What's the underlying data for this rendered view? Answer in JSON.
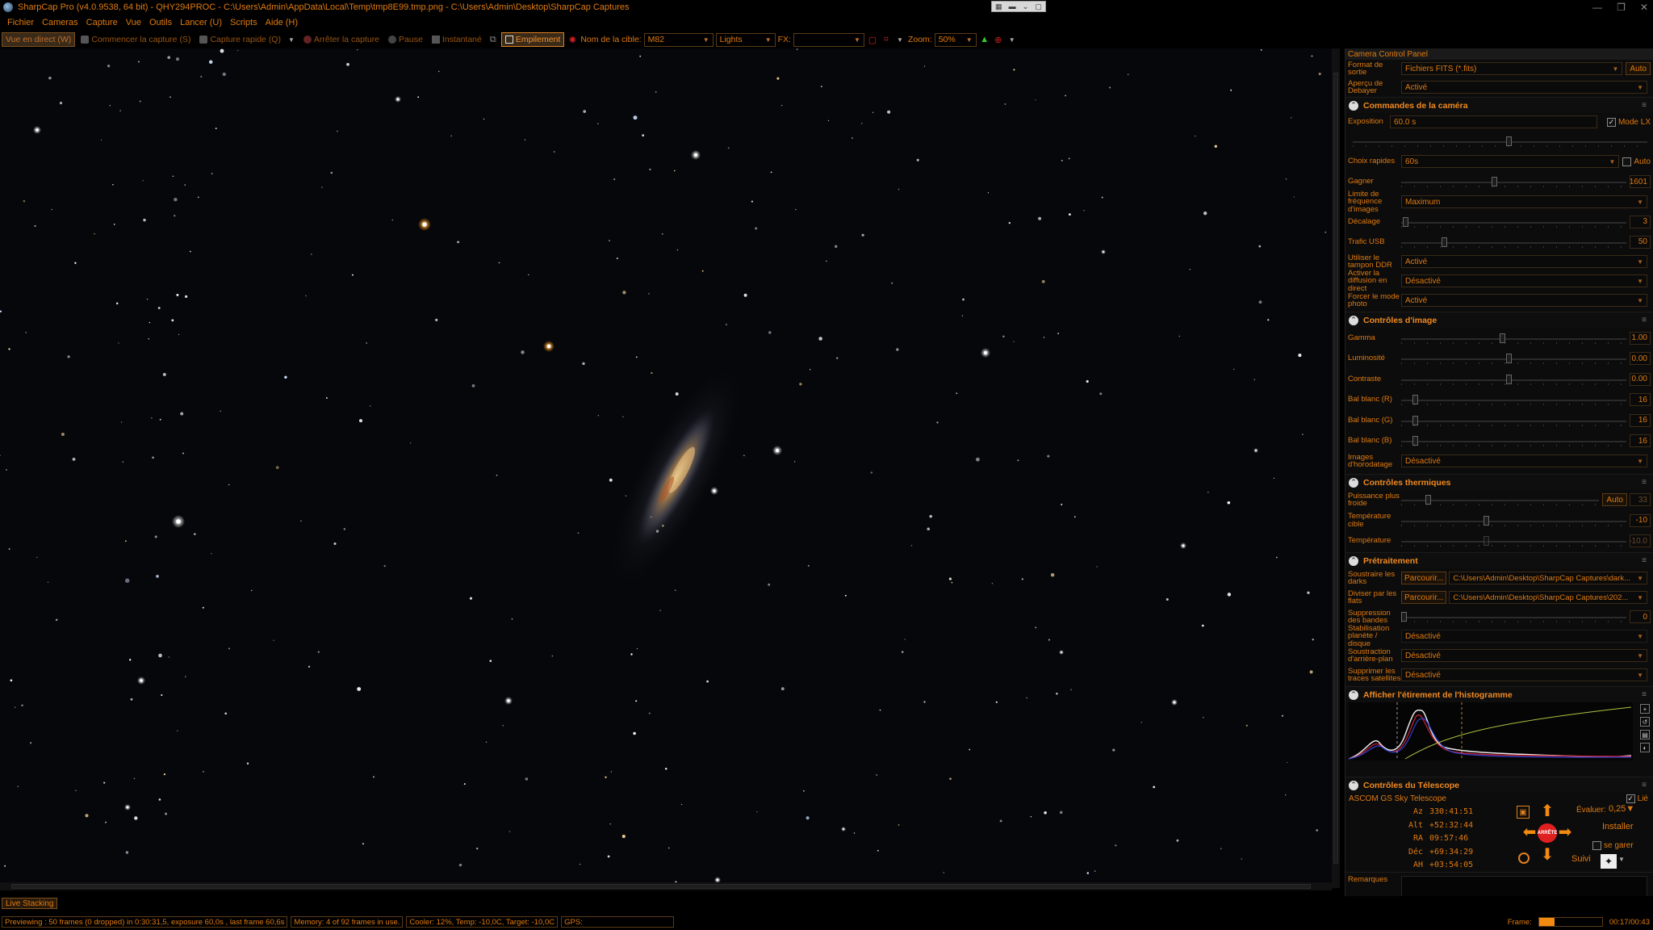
{
  "window": {
    "title": "SharpCap Pro (v4.0.9538, 64 bit) - QHY294PROC - C:\\Users\\Admin\\AppData\\Local\\Temp\\tmp8E99.tmp.png - C:\\Users\\Admin\\Desktop\\SharpCap Captures",
    "controls": [
      "—",
      "❐",
      "✕"
    ]
  },
  "menu": [
    "Fichier",
    "Cameras",
    "Capture",
    "Vue",
    "Outils",
    "Lancer (U)",
    "Scripts",
    "Aide (H)"
  ],
  "toolbar": {
    "live_view": "Vue en direct (W)",
    "start_capture": "Commencer la capture (S)",
    "quick_capture": "Capture rapide (Q)",
    "stop_capture": "Arrêter la capture",
    "pause": "Pause",
    "snapshot": "Instantané",
    "stacking": "Empilement",
    "target_label": "Nom de la cible:",
    "target_value": "M82",
    "frame_type": "Lights",
    "fx_label": "FX:",
    "fx_value": "",
    "zoom_label": "Zoom:",
    "zoom_value": "50%"
  },
  "panel": {
    "title": "Camera Control Panel",
    "output_format": {
      "label": "Format de sortie",
      "value": "Fichiers FITS (*.fits)",
      "auto": "Auto"
    },
    "debayer_preview": {
      "label": "Aperçu de Debayer",
      "value": "Activé"
    },
    "camera_controls": {
      "title": "Commandes de la caméra",
      "exposure": {
        "label": "Exposition",
        "value": "60.0 s",
        "lx_mode": "Mode LX"
      },
      "quick_picks": {
        "label": "Choix rapides",
        "value": "60s",
        "auto": "Auto"
      },
      "gain": {
        "label": "Gagner",
        "value": "1601"
      },
      "frame_limit": {
        "label": "Limite de fréquence d'images",
        "value": "Maximum"
      },
      "offset": {
        "label": "Décalage",
        "value": "3"
      },
      "usb_traffic": {
        "label": "Trafic USB",
        "value": "50"
      },
      "ddr_buffer": {
        "label": "Utiliser le tampon DDR",
        "value": "Activé"
      },
      "live_broadcast": {
        "label": "Activer la diffusion en direct",
        "value": "Désactivé"
      },
      "photo_mode": {
        "label": "Forcer le mode photo",
        "value": "Activé"
      }
    },
    "image_controls": {
      "title": "Contrôles d'image",
      "gamma": {
        "label": "Gamma",
        "value": "1.00"
      },
      "brightness": {
        "label": "Luminosité",
        "value": "0.00"
      },
      "contrast": {
        "label": "Contraste",
        "value": "0.00"
      },
      "wb_r": {
        "label": "Bal blanc (R)",
        "value": "16"
      },
      "wb_g": {
        "label": "Bal blanc (G)",
        "value": "16"
      },
      "wb_b": {
        "label": "Bal blanc (B)",
        "value": "16"
      },
      "timestamp": {
        "label": "Images d'horodatage",
        "value": "Désactivé"
      }
    },
    "thermal_controls": {
      "title": "Contrôles thermiques",
      "cooler_power": {
        "label": "Puissance plus froide",
        "auto": "Auto",
        "value": "33"
      },
      "target_temp": {
        "label": "Température cible",
        "value": "-10"
      },
      "temperature": {
        "label": "Température",
        "value": "-10.0"
      }
    },
    "preprocessing": {
      "title": "Prétraitement",
      "subtract_darks": {
        "label": "Soustraire les darks",
        "browse": "Parcourir...",
        "path": "C:\\Users\\Admin\\Desktop\\SharpCap Captures\\dark..."
      },
      "divide_flats": {
        "label": "Diviser par les flats",
        "browse": "Parcourir...",
        "path": "C:\\Users\\Admin\\Desktop\\SharpCap Captures\\202..."
      },
      "banding": {
        "label": "Suppression des bandes",
        "value": "0"
      },
      "stabilization": {
        "label": "Stabilisation planète / disque",
        "value": "Désactivé"
      },
      "background": {
        "label": "Soustraction d'arrière-plan",
        "value": "Désactivé"
      },
      "satellite": {
        "label": "Supprimer les traces satellites",
        "value": "Désactivé"
      }
    },
    "histogram": {
      "title": "Afficher l'étirement de l'histogramme"
    },
    "telescope": {
      "title": "Contrôles du Télescope",
      "driver": "ASCOM GS Sky Telescope",
      "linked": "Lié",
      "rate_label": "Évaluer:",
      "rate_value": "0,25",
      "install": "Installer",
      "park": "se garer",
      "track": "Suivi",
      "stop": "ARRÊTE",
      "coords": [
        {
          "k": "Az",
          "v": "330:41:51"
        },
        {
          "k": "Alt",
          "v": "+52:32:44"
        },
        {
          "k": "RA",
          "v": "09:57:46"
        },
        {
          "k": "Déc",
          "v": "+69:34:29"
        },
        {
          "k": "AH",
          "v": "+03:54:05"
        }
      ]
    },
    "notes_label": "Remarques"
  },
  "live_tab": "Live Stacking",
  "status": {
    "preview": "Previewing : 50 frames (0 dropped) in 0:30:31,5, exposure 60,0s , last frame 60,6s",
    "memory": "Memory: 4 of 92 frames in use.",
    "cooler": "Cooler: 12%, Temp: -10,0C, Target: -10,0C",
    "gps": "GPS:",
    "frame_label": "Frame:",
    "elapsed": "00:17/00:43"
  },
  "colors": {
    "accent": "#e07a10",
    "background": "#000000",
    "stop": "#e02020"
  }
}
